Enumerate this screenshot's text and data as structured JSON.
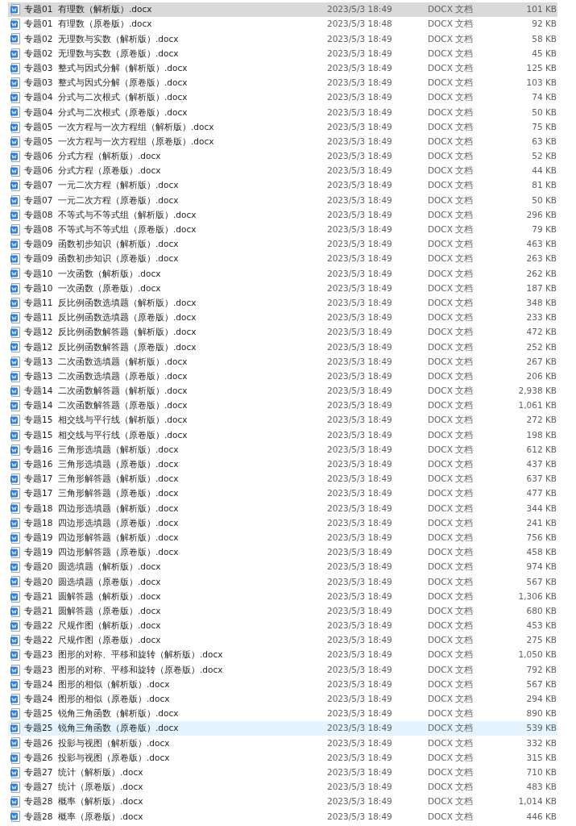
{
  "files": [
    {
      "name": "专题01  有理数（解析版）.docx",
      "modified": "2023/5/3 18:49",
      "type": "DOCX 文档",
      "size": "101 KB",
      "selected": true,
      "hovered": false
    },
    {
      "name": "专题01  有理数（原卷版）.docx",
      "modified": "2023/5/3 18:48",
      "type": "DOCX 文档",
      "size": "92 KB",
      "selected": false,
      "hovered": false
    },
    {
      "name": "专题02  无理数与实数（解析版）.docx",
      "modified": "2023/5/3 18:49",
      "type": "DOCX 文档",
      "size": "58 KB",
      "selected": false,
      "hovered": false
    },
    {
      "name": "专题02  无理数与实数（原卷版）.docx",
      "modified": "2023/5/3 18:49",
      "type": "DOCX 文档",
      "size": "45 KB",
      "selected": false,
      "hovered": false
    },
    {
      "name": "专题03  整式与因式分解（解析版）.docx",
      "modified": "2023/5/3 18:49",
      "type": "DOCX 文档",
      "size": "125 KB",
      "selected": false,
      "hovered": false
    },
    {
      "name": "专题03  整式与因式分解（原卷版）.docx",
      "modified": "2023/5/3 18:49",
      "type": "DOCX 文档",
      "size": "103 KB",
      "selected": false,
      "hovered": false
    },
    {
      "name": "专题04  分式与二次根式（解析版）.docx",
      "modified": "2023/5/3 18:49",
      "type": "DOCX 文档",
      "size": "74 KB",
      "selected": false,
      "hovered": false
    },
    {
      "name": "专题04  分式与二次根式（原卷版）.docx",
      "modified": "2023/5/3 18:49",
      "type": "DOCX 文档",
      "size": "50 KB",
      "selected": false,
      "hovered": false
    },
    {
      "name": "专题05  一次方程与一次方程组（解析版）.docx",
      "modified": "2023/5/3 18:49",
      "type": "DOCX 文档",
      "size": "75 KB",
      "selected": false,
      "hovered": false
    },
    {
      "name": "专题05  一次方程与一次方程组（原卷版）.docx",
      "modified": "2023/5/3 18:49",
      "type": "DOCX 文档",
      "size": "63 KB",
      "selected": false,
      "hovered": false
    },
    {
      "name": "专题06  分式方程（解析版）.docx",
      "modified": "2023/5/3 18:49",
      "type": "DOCX 文档",
      "size": "52 KB",
      "selected": false,
      "hovered": false
    },
    {
      "name": "专题06  分式方程（原卷版）.docx",
      "modified": "2023/5/3 18:49",
      "type": "DOCX 文档",
      "size": "44 KB",
      "selected": false,
      "hovered": false
    },
    {
      "name": "专题07  一元二次方程（解析版）.docx",
      "modified": "2023/5/3 18:49",
      "type": "DOCX 文档",
      "size": "81 KB",
      "selected": false,
      "hovered": false
    },
    {
      "name": "专题07  一元二次方程（原卷版）.docx",
      "modified": "2023/5/3 18:49",
      "type": "DOCX 文档",
      "size": "50 KB",
      "selected": false,
      "hovered": false
    },
    {
      "name": "专题08  不等式与不等式组（解析版）.docx",
      "modified": "2023/5/3 18:49",
      "type": "DOCX 文档",
      "size": "296 KB",
      "selected": false,
      "hovered": false
    },
    {
      "name": "专题08  不等式与不等式组（原卷版）.docx",
      "modified": "2023/5/3 18:49",
      "type": "DOCX 文档",
      "size": "79 KB",
      "selected": false,
      "hovered": false
    },
    {
      "name": "专题09  函数初步知识（解析版）.docx",
      "modified": "2023/5/3 18:49",
      "type": "DOCX 文档",
      "size": "463 KB",
      "selected": false,
      "hovered": false
    },
    {
      "name": "专题09  函数初步知识（原卷版）.docx",
      "modified": "2023/5/3 18:49",
      "type": "DOCX 文档",
      "size": "263 KB",
      "selected": false,
      "hovered": false
    },
    {
      "name": "专题10  一次函数（解析版）.docx",
      "modified": "2023/5/3 18:49",
      "type": "DOCX 文档",
      "size": "262 KB",
      "selected": false,
      "hovered": false
    },
    {
      "name": "专题10  一次函数（原卷版）.docx",
      "modified": "2023/5/3 18:49",
      "type": "DOCX 文档",
      "size": "187 KB",
      "selected": false,
      "hovered": false
    },
    {
      "name": "专题11  反比例函数选填题（解析版）.docx",
      "modified": "2023/5/3 18:49",
      "type": "DOCX 文档",
      "size": "348 KB",
      "selected": false,
      "hovered": false
    },
    {
      "name": "专题11  反比例函数选填题（原卷版）.docx",
      "modified": "2023/5/3 18:49",
      "type": "DOCX 文档",
      "size": "233 KB",
      "selected": false,
      "hovered": false
    },
    {
      "name": "专题12  反比例函数解答题（解析版）.docx",
      "modified": "2023/5/3 18:49",
      "type": "DOCX 文档",
      "size": "472 KB",
      "selected": false,
      "hovered": false
    },
    {
      "name": "专题12  反比例函数解答题（原卷版）.docx",
      "modified": "2023/5/3 18:49",
      "type": "DOCX 文档",
      "size": "252 KB",
      "selected": false,
      "hovered": false
    },
    {
      "name": "专题13  二次函数选填题（解析版）.docx",
      "modified": "2023/5/3 18:49",
      "type": "DOCX 文档",
      "size": "267 KB",
      "selected": false,
      "hovered": false
    },
    {
      "name": "专题13  二次函数选填题（原卷版）.docx",
      "modified": "2023/5/3 18:49",
      "type": "DOCX 文档",
      "size": "206 KB",
      "selected": false,
      "hovered": false
    },
    {
      "name": "专题14  二次函数解答题（解析版）.docx",
      "modified": "2023/5/3 18:49",
      "type": "DOCX 文档",
      "size": "2,938 KB",
      "selected": false,
      "hovered": false
    },
    {
      "name": "专题14  二次函数解答题（原卷版）.docx",
      "modified": "2023/5/3 18:49",
      "type": "DOCX 文档",
      "size": "1,061 KB",
      "selected": false,
      "hovered": false
    },
    {
      "name": "专题15  相交线与平行线（解析版）.docx",
      "modified": "2023/5/3 18:49",
      "type": "DOCX 文档",
      "size": "272 KB",
      "selected": false,
      "hovered": false
    },
    {
      "name": "专题15  相交线与平行线（原卷版）.docx",
      "modified": "2023/5/3 18:49",
      "type": "DOCX 文档",
      "size": "198 KB",
      "selected": false,
      "hovered": false
    },
    {
      "name": "专题16  三角形选填题（解析版）.docx",
      "modified": "2023/5/3 18:49",
      "type": "DOCX 文档",
      "size": "612 KB",
      "selected": false,
      "hovered": false
    },
    {
      "name": "专题16  三角形选填题（原卷版）.docx",
      "modified": "2023/5/3 18:49",
      "type": "DOCX 文档",
      "size": "437 KB",
      "selected": false,
      "hovered": false
    },
    {
      "name": "专题17  三角形解答题（解析版）.docx",
      "modified": "2023/5/3 18:49",
      "type": "DOCX 文档",
      "size": "637 KB",
      "selected": false,
      "hovered": false
    },
    {
      "name": "专题17  三角形解答题（原卷版）.docx",
      "modified": "2023/5/3 18:49",
      "type": "DOCX 文档",
      "size": "477 KB",
      "selected": false,
      "hovered": false
    },
    {
      "name": "专题18  四边形选填题（解析版）.docx",
      "modified": "2023/5/3 18:49",
      "type": "DOCX 文档",
      "size": "344 KB",
      "selected": false,
      "hovered": false
    },
    {
      "name": "专题18  四边形选填题（原卷版）.docx",
      "modified": "2023/5/3 18:49",
      "type": "DOCX 文档",
      "size": "241 KB",
      "selected": false,
      "hovered": false
    },
    {
      "name": "专题19  四边形解答题（解析版）.docx",
      "modified": "2023/5/3 18:49",
      "type": "DOCX 文档",
      "size": "756 KB",
      "selected": false,
      "hovered": false
    },
    {
      "name": "专题19  四边形解答题（原卷版）.docx",
      "modified": "2023/5/3 18:49",
      "type": "DOCX 文档",
      "size": "458 KB",
      "selected": false,
      "hovered": false
    },
    {
      "name": "专题20  圆选填题（解析版）.docx",
      "modified": "2023/5/3 18:49",
      "type": "DOCX 文档",
      "size": "974 KB",
      "selected": false,
      "hovered": false
    },
    {
      "name": "专题20  圆选填题（原卷版）.docx",
      "modified": "2023/5/3 18:49",
      "type": "DOCX 文档",
      "size": "567 KB",
      "selected": false,
      "hovered": false
    },
    {
      "name": "专题21  圆解答题（解析版）.docx",
      "modified": "2023/5/3 18:49",
      "type": "DOCX 文档",
      "size": "1,306 KB",
      "selected": false,
      "hovered": false
    },
    {
      "name": "专题21  圆解答题（原卷版）.docx",
      "modified": "2023/5/3 18:49",
      "type": "DOCX 文档",
      "size": "680 KB",
      "selected": false,
      "hovered": false
    },
    {
      "name": "专题22  尺规作图（解析版）.docx",
      "modified": "2023/5/3 18:49",
      "type": "DOCX 文档",
      "size": "453 KB",
      "selected": false,
      "hovered": false
    },
    {
      "name": "专题22  尺规作图（原卷版）.docx",
      "modified": "2023/5/3 18:49",
      "type": "DOCX 文档",
      "size": "275 KB",
      "selected": false,
      "hovered": false
    },
    {
      "name": "专题23  图形的对称、平移和旋转（解析版）.docx",
      "modified": "2023/5/3 18:49",
      "type": "DOCX 文档",
      "size": "1,050 KB",
      "selected": false,
      "hovered": false
    },
    {
      "name": "专题23  图形的对称、平移和旋转（原卷版）.docx",
      "modified": "2023/5/3 18:49",
      "type": "DOCX 文档",
      "size": "792 KB",
      "selected": false,
      "hovered": false
    },
    {
      "name": "专题24  图形的相似（解析版）.docx",
      "modified": "2023/5/3 18:49",
      "type": "DOCX 文档",
      "size": "567 KB",
      "selected": false,
      "hovered": false
    },
    {
      "name": "专题24  图形的相似（原卷版）.docx",
      "modified": "2023/5/3 18:49",
      "type": "DOCX 文档",
      "size": "294 KB",
      "selected": false,
      "hovered": false
    },
    {
      "name": "专题25  锐角三角函数（解析版）.docx",
      "modified": "2023/5/3 18:49",
      "type": "DOCX 文档",
      "size": "890 KB",
      "selected": false,
      "hovered": false
    },
    {
      "name": "专题25  锐角三角函数（原卷版）.docx",
      "modified": "2023/5/3 18:49",
      "type": "DOCX 文档",
      "size": "539 KB",
      "selected": false,
      "hovered": true
    },
    {
      "name": "专题26  投影与视图（解析版）.docx",
      "modified": "2023/5/3 18:49",
      "type": "DOCX 文档",
      "size": "332 KB",
      "selected": false,
      "hovered": false
    },
    {
      "name": "专题26  投影与视图（原卷版）.docx",
      "modified": "2023/5/3 18:49",
      "type": "DOCX 文档",
      "size": "315 KB",
      "selected": false,
      "hovered": false
    },
    {
      "name": "专题27  统计（解析版）.docx",
      "modified": "2023/5/3 18:49",
      "type": "DOCX 文档",
      "size": "710 KB",
      "selected": false,
      "hovered": false
    },
    {
      "name": "专题27  统计（原卷版）.docx",
      "modified": "2023/5/3 18:49",
      "type": "DOCX 文档",
      "size": "483 KB",
      "selected": false,
      "hovered": false
    },
    {
      "name": "专题28  概率（解析版）.docx",
      "modified": "2023/5/3 18:49",
      "type": "DOCX 文档",
      "size": "1,014 KB",
      "selected": false,
      "hovered": false
    },
    {
      "name": "专题28  概率（原卷版）.docx",
      "modified": "2023/5/3 18:49",
      "type": "DOCX 文档",
      "size": "446 KB",
      "selected": false,
      "hovered": false
    }
  ]
}
